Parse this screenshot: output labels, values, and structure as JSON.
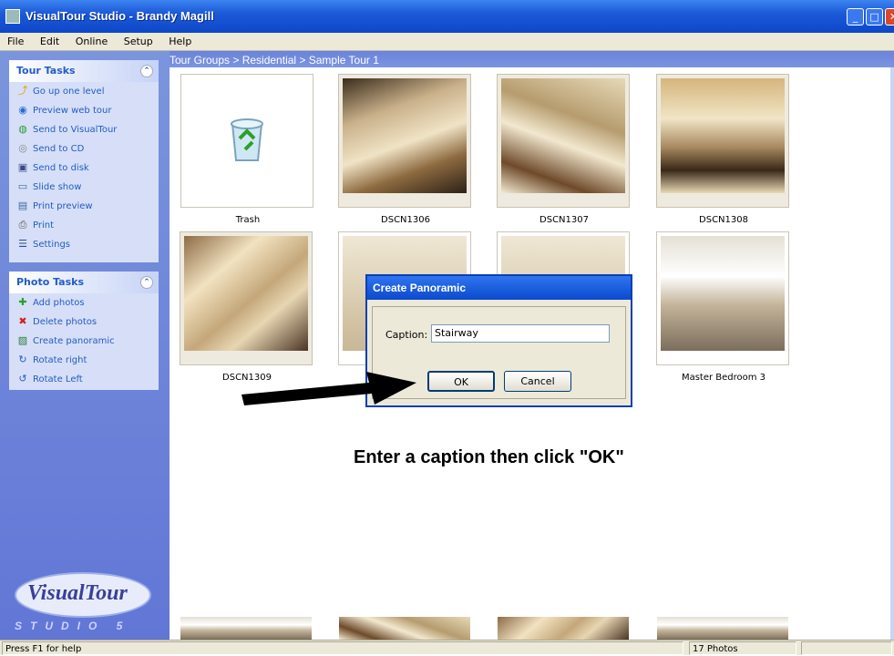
{
  "window": {
    "title": "VisualTour Studio - Brandy Magill",
    "buttons": [
      "minimize",
      "maximize",
      "close"
    ]
  },
  "menu": [
    "File",
    "Edit",
    "Online",
    "Setup",
    "Help"
  ],
  "breadcrumb": "Tour Groups > Residential > Sample Tour 1",
  "tour_tasks": {
    "title": "Tour Tasks",
    "items": [
      {
        "label": "Go up one level",
        "icon": "up-folder-icon"
      },
      {
        "label": "Preview web tour",
        "icon": "preview-icon"
      },
      {
        "label": "Send to VisualTour",
        "icon": "globe-icon"
      },
      {
        "label": "Send to CD",
        "icon": "cd-icon"
      },
      {
        "label": "Send to disk",
        "icon": "disk-icon"
      },
      {
        "label": "Slide show",
        "icon": "slideshow-icon"
      },
      {
        "label": "Print preview",
        "icon": "print-preview-icon"
      },
      {
        "label": "Print",
        "icon": "printer-icon"
      },
      {
        "label": "Settings",
        "icon": "settings-icon"
      }
    ]
  },
  "photo_tasks": {
    "title": "Photo Tasks",
    "items": [
      {
        "label": "Add photos",
        "icon": "add-icon"
      },
      {
        "label": "Delete photos",
        "icon": "delete-icon"
      },
      {
        "label": "Create panoramic",
        "icon": "panoramic-icon"
      },
      {
        "label": "Rotate right",
        "icon": "rotate-right-icon"
      },
      {
        "label": "Rotate Left",
        "icon": "rotate-left-icon"
      }
    ]
  },
  "logo": {
    "brand": "VisualTour",
    "sub": "STUDIO 5"
  },
  "thumbnails": [
    {
      "caption": "Trash"
    },
    {
      "caption": "DSCN1306"
    },
    {
      "caption": "DSCN1307"
    },
    {
      "caption": "DSCN1308"
    },
    {
      "caption": "DSCN1309"
    },
    {
      "caption": ""
    },
    {
      "caption": ""
    },
    {
      "caption": "Master Bedroom 3"
    }
  ],
  "dialog": {
    "title": "Create Panoramic",
    "caption_label": "Caption:",
    "caption_value": "Stairway",
    "ok": "OK",
    "cancel": "Cancel"
  },
  "instruction": "Enter a caption then click \"OK\"",
  "status": {
    "help": "Press F1 for help",
    "count": "17 Photos"
  },
  "colors": {
    "title_bar": "#0d47c9",
    "sidebar": "#6276d6",
    "link": "#215dc6"
  }
}
